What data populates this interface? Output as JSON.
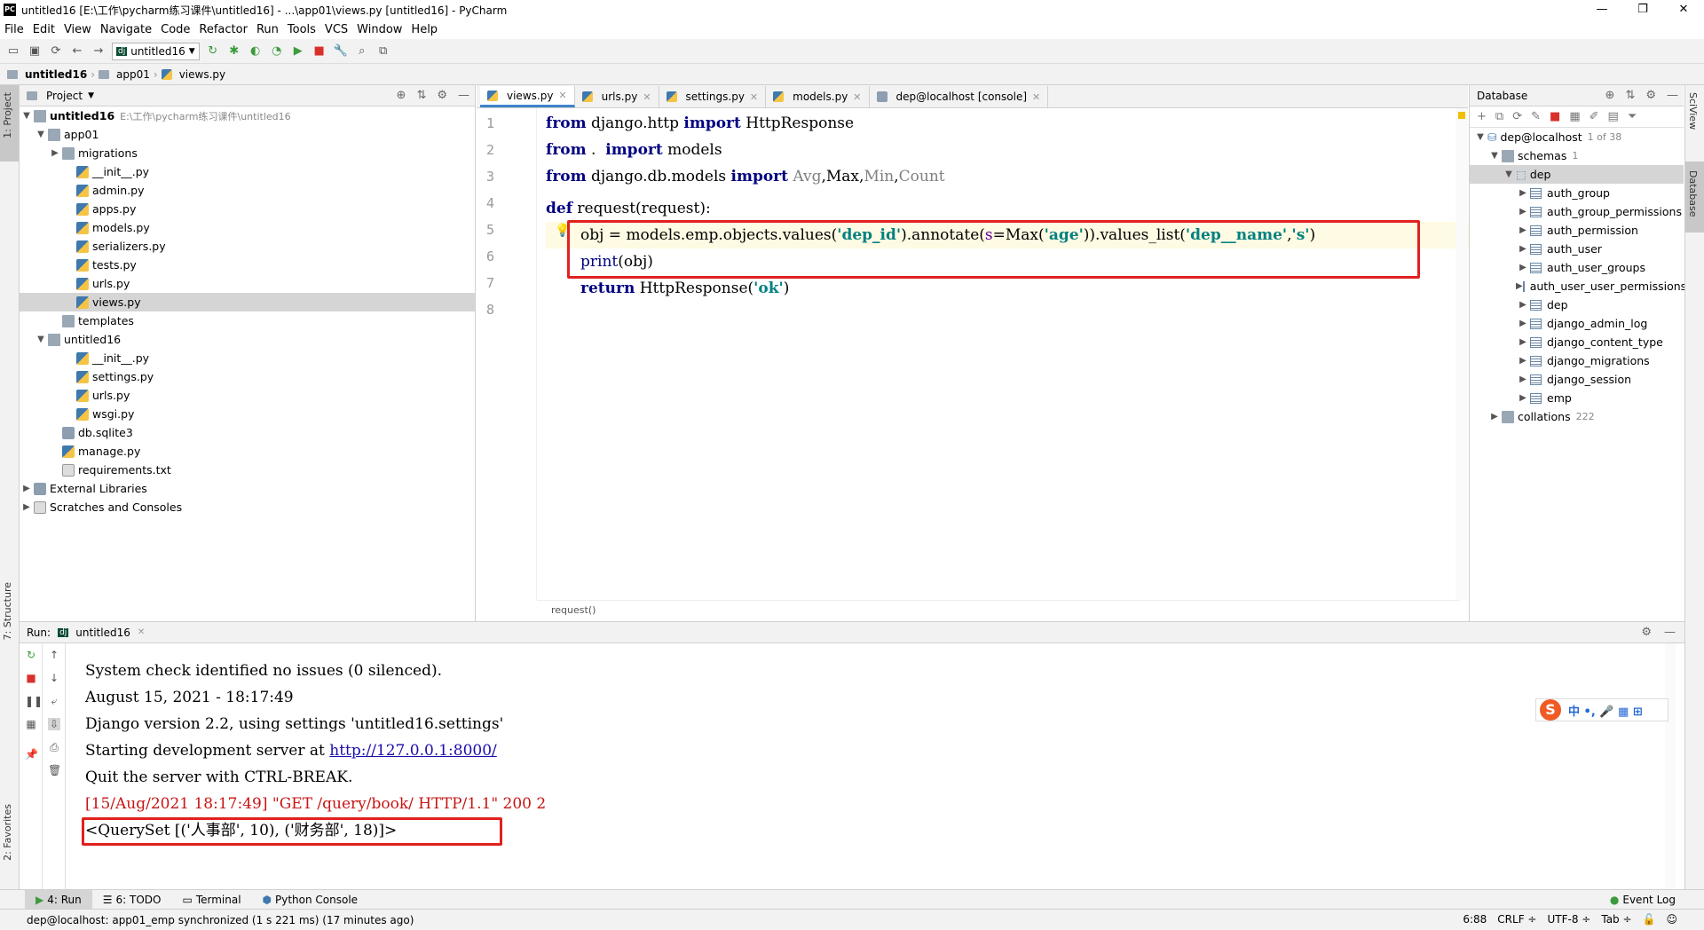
{
  "window": {
    "title": "untitled16 [E:\\工作\\pycharm练习课件\\untitled16] - ...\\app01\\views.py [untitled16] - PyCharm",
    "icon_text": "PC",
    "minimize": "—",
    "restore": "❐",
    "close": "✕"
  },
  "menu": [
    "File",
    "Edit",
    "View",
    "Navigate",
    "Code",
    "Refactor",
    "Run",
    "Tools",
    "VCS",
    "Window",
    "Help"
  ],
  "toolbar": {
    "run_config": "untitled16"
  },
  "breadcrumb": [
    "untitled16",
    "app01",
    "views.py"
  ],
  "left_strip": {
    "project": "1: Project",
    "structure": "7: Structure",
    "favorites": "2: Favorites"
  },
  "project": {
    "header": "Project",
    "root": {
      "name": "untitled16",
      "path": "E:\\工作\\pycharm练习课件\\untitled16"
    },
    "items": [
      {
        "name": "app01",
        "depth": 1,
        "type": "folder",
        "open": true
      },
      {
        "name": "migrations",
        "depth": 2,
        "type": "folder",
        "open": false
      },
      {
        "name": "__init__.py",
        "depth": 3,
        "type": "py"
      },
      {
        "name": "admin.py",
        "depth": 3,
        "type": "py"
      },
      {
        "name": "apps.py",
        "depth": 3,
        "type": "py"
      },
      {
        "name": "models.py",
        "depth": 3,
        "type": "py"
      },
      {
        "name": "serializers.py",
        "depth": 3,
        "type": "py"
      },
      {
        "name": "tests.py",
        "depth": 3,
        "type": "py"
      },
      {
        "name": "urls.py",
        "depth": 3,
        "type": "py"
      },
      {
        "name": "views.py",
        "depth": 3,
        "type": "py",
        "selected": true
      },
      {
        "name": "templates",
        "depth": 2,
        "type": "folder"
      },
      {
        "name": "untitled16",
        "depth": 1,
        "type": "folder",
        "open": true
      },
      {
        "name": "__init__.py",
        "depth": 3,
        "type": "py"
      },
      {
        "name": "settings.py",
        "depth": 3,
        "type": "py"
      },
      {
        "name": "urls.py",
        "depth": 3,
        "type": "py"
      },
      {
        "name": "wsgi.py",
        "depth": 3,
        "type": "py"
      },
      {
        "name": "db.sqlite3",
        "depth": 2,
        "type": "db"
      },
      {
        "name": "manage.py",
        "depth": 2,
        "type": "py"
      },
      {
        "name": "requirements.txt",
        "depth": 2,
        "type": "txt"
      },
      {
        "name": "External Libraries",
        "depth": 0,
        "type": "lib"
      },
      {
        "name": "Scratches and Consoles",
        "depth": 0,
        "type": "scratch"
      }
    ]
  },
  "tabs": [
    {
      "label": "views.py",
      "active": true
    },
    {
      "label": "urls.py"
    },
    {
      "label": "settings.py"
    },
    {
      "label": "models.py"
    },
    {
      "label": "dep@localhost [console]"
    }
  ],
  "code": {
    "line_numbers": [
      "1",
      "2",
      "3",
      "4",
      "5",
      "6",
      "7",
      "8"
    ],
    "l1": {
      "from": "from",
      "mod": " django.http ",
      "import": "import",
      "name": " HttpResponse"
    },
    "l2": {
      "from": "from",
      "mod": " .  ",
      "import": "import",
      "name": " models"
    },
    "l3": {
      "from": "from",
      "mod": " django.db.models ",
      "import": "import",
      "avg": " Avg",
      "c1": ",",
      "max": "Max",
      "c2": ",",
      "min": "Min",
      "c3": ",",
      "count": "Count"
    },
    "l5": {
      "def": "def",
      "sig": " request(request):"
    },
    "l6": {
      "a": "obj = models.emp.objects.values(",
      "s1": "'dep_id'",
      "b": ").annotate(",
      "kwa": "s",
      "c": "=Max(",
      "s2": "'age'",
      "d": ")).values_list(",
      "s3": "'dep__name'",
      "e": ",",
      "s4": "'s'",
      "f": ")"
    },
    "l7": {
      "print": "print",
      "rest": "(obj)"
    },
    "l8": {
      "ret": "return",
      "a": " HttpResponse(",
      "s": "'ok'",
      "b": ")"
    },
    "status": "request()"
  },
  "database": {
    "header": "Database",
    "host": "dep@localhost",
    "host_count": "1 of 38",
    "schemas": "schemas",
    "schemas_count": "1",
    "schema": "dep",
    "tables": [
      "auth_group",
      "auth_group_permissions",
      "auth_permission",
      "auth_user",
      "auth_user_groups",
      "auth_user_user_permissions",
      "dep",
      "django_admin_log",
      "django_content_type",
      "django_migrations",
      "django_session",
      "emp"
    ],
    "collations": "collations",
    "collations_count": "222"
  },
  "right_strip": {
    "sciview": "SciView",
    "database": "Database"
  },
  "run": {
    "label": "Run:",
    "config": "untitled16",
    "lines": [
      "System check identified no issues (0 silenced).",
      "August 15, 2021 - 18:17:49",
      "Django version 2.2, using settings 'untitled16.settings'",
      "Starting development server at ",
      "Quit the server with CTRL-BREAK."
    ],
    "url": "http://127.0.0.1:8000/",
    "log": "[15/Aug/2021 18:17:49] \"GET /query/book/ HTTP/1.1\" 200 2",
    "result": "<QuerySet [('人事部', 10), ('财务部', 18)]>"
  },
  "ime": {
    "logo": "S",
    "text": "中 •, 🎤 ▦ ⊞"
  },
  "bottom_tabs": [
    "4: Run",
    "6: TODO",
    "Terminal",
    "Python Console"
  ],
  "event_log": "Event Log",
  "status": {
    "message": "dep@localhost: app01_emp synchronized (1 s 221 ms) (17 minutes ago)",
    "position": "6:88",
    "line_sep": "CRLF ÷",
    "encoding": "UTF-8 ÷",
    "indent": "Tab ÷"
  },
  "colors": {
    "accent": "#4083c9",
    "highlight_box": "#e0211f",
    "keyword": "#000080",
    "string": "#008080",
    "log_red": "#c81414"
  }
}
